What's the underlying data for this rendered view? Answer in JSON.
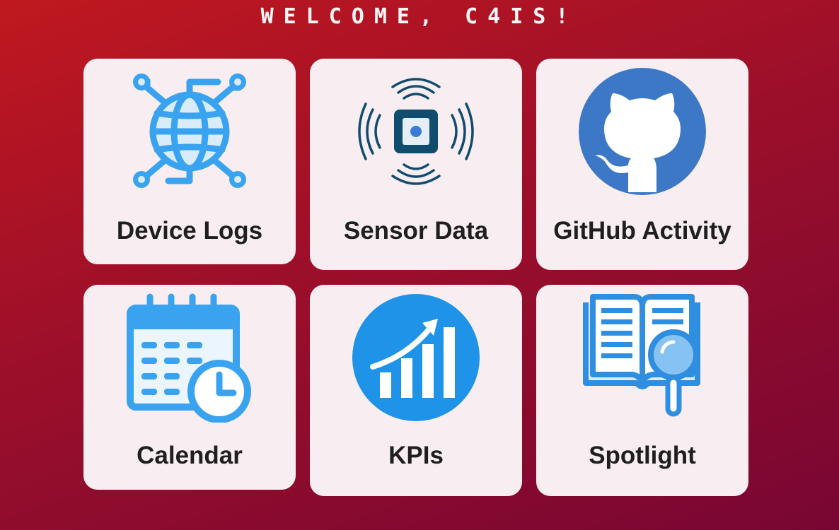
{
  "header": {
    "welcome": "WELCOME, C4IS!"
  },
  "tiles": [
    {
      "label": "Device Logs",
      "icon": "globe-network-icon"
    },
    {
      "label": "Sensor Data",
      "icon": "sensor-signal-icon"
    },
    {
      "label": "GitHub Activity",
      "icon": "github-icon"
    },
    {
      "label": "Calendar",
      "icon": "calendar-clock-icon"
    },
    {
      "label": "KPIs",
      "icon": "growth-chart-icon"
    },
    {
      "label": "Spotlight",
      "icon": "book-magnifier-icon"
    }
  ],
  "colors": {
    "background_start": "#c0181f",
    "background_end": "#780633",
    "tile": "#f8eef1",
    "icon_blue": "#3aa3f0",
    "github_blue": "#3d78c7",
    "sensor_navy": "#0f4c6e"
  }
}
